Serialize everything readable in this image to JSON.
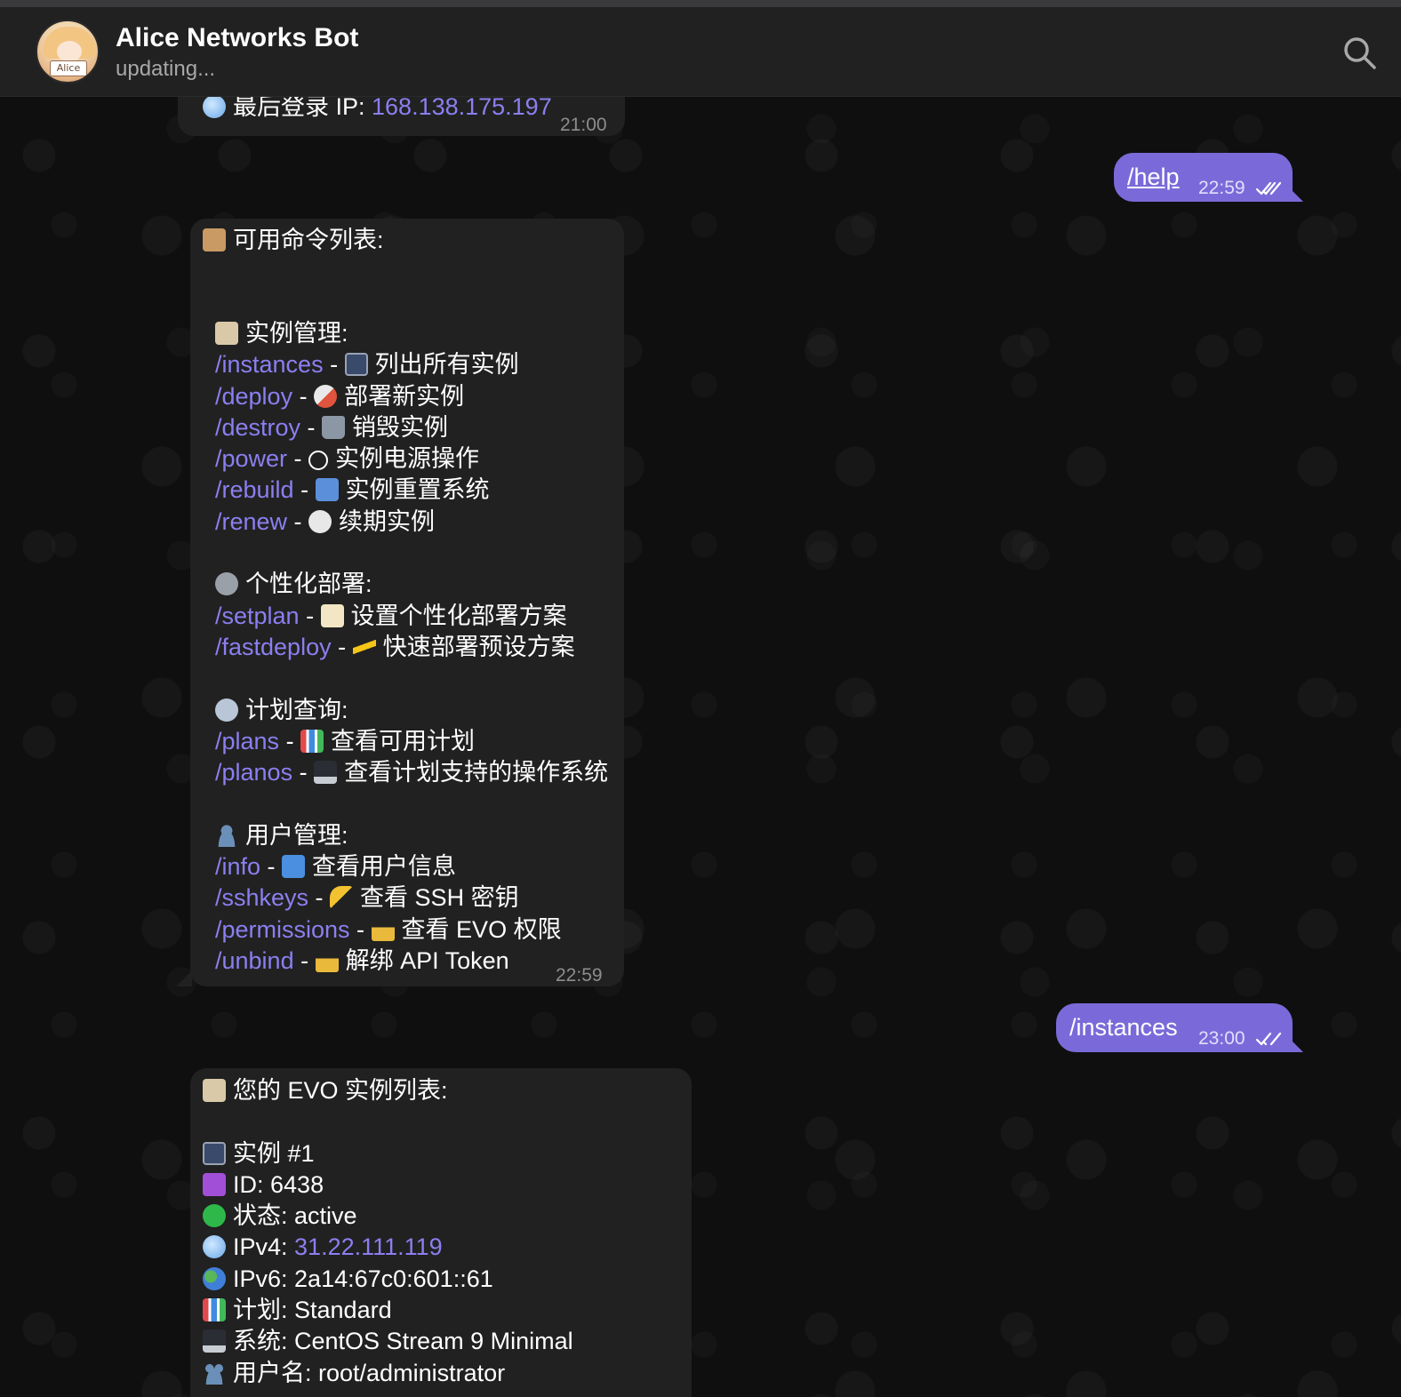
{
  "header": {
    "title": "Alice Networks Bot",
    "status": "updating...",
    "avatar_label": "Alice"
  },
  "messages": {
    "m1": {
      "prefix": "最后登录 IP: ",
      "ip": "168.138.175.197",
      "time": "21:00"
    },
    "m2": {
      "text": "/help",
      "time": "22:59"
    },
    "m3": {
      "title": "可用命令列表:",
      "sec1": "实例管理:",
      "sec2": "个性化部署:",
      "sec3": "计划查询:",
      "sec4": "用户管理:",
      "commands": [
        {
          "cmd": "/instances",
          "desc": "列出所有实例"
        },
        {
          "cmd": "/deploy",
          "desc": "部署新实例"
        },
        {
          "cmd": "/destroy",
          "desc": "销毁实例"
        },
        {
          "cmd": "/power",
          "desc": "实例电源操作"
        },
        {
          "cmd": "/rebuild",
          "desc": "实例重置系统"
        },
        {
          "cmd": "/renew",
          "desc": "续期实例"
        },
        {
          "cmd": "/setplan",
          "desc": "设置个性化部署方案"
        },
        {
          "cmd": "/fastdeploy",
          "desc": "快速部署预设方案"
        },
        {
          "cmd": "/plans",
          "desc": "查看可用计划"
        },
        {
          "cmd": "/planos",
          "desc": "查看计划支持的操作系统"
        },
        {
          "cmd": "/info",
          "desc": "查看用户信息"
        },
        {
          "cmd": "/sshkeys",
          "desc": "查看 SSH 密钥"
        },
        {
          "cmd": "/permissions",
          "desc": "查看 EVO 权限"
        },
        {
          "cmd": "/unbind",
          "desc": "解绑 API Token"
        }
      ],
      "sep": " - ",
      "time": "22:59"
    },
    "m4": {
      "text": "/instances",
      "time": "23:00"
    },
    "m5": {
      "title": "您的 EVO 实例列表:",
      "instance": "实例 #1",
      "id_label": "ID: ",
      "id_value": "6438",
      "status_label": "状态: ",
      "status_value": "active",
      "ipv4_label": "IPv4: ",
      "ipv4_value": "31.22.111.119",
      "ipv6_label": "IPv6: ",
      "ipv6_value": "2a14:67c0:601::61",
      "plan_label": "计划: ",
      "plan_value": "Standard",
      "os_label": "系统: ",
      "os_value": "CentOS Stream 9 Minimal",
      "user_label": "用户名: ",
      "user_value": "root/administrator"
    }
  },
  "colors": {
    "accent": "#7a6ad9",
    "link": "#8b7ff0",
    "bubble_in": "#212121",
    "header_bg": "#212121",
    "chat_bg": "#0f0f0f"
  }
}
